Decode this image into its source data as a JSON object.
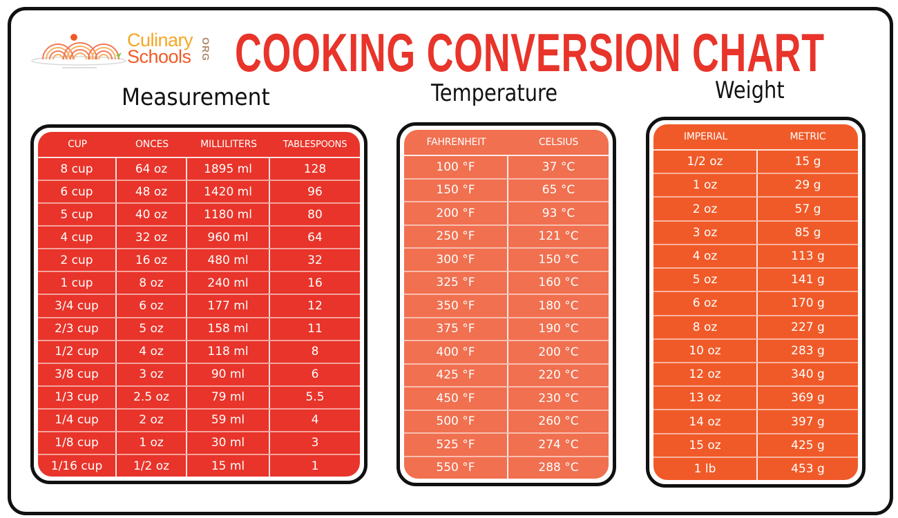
{
  "header": {
    "brand_line1": "Culinary",
    "brand_line2": "Schools",
    "brand_suffix": "ORG",
    "title": "COOKING CONVERSION CHART",
    "logo_icon": "spaghetti-plate-icon"
  },
  "colors": {
    "title_red": "#e8342a",
    "measurement_bg": "#e8342a",
    "temperature_bg": "#f07050",
    "weight_bg": "#f05a28",
    "brand_yellow": "#f5a623",
    "brand_orange": "#f05a28"
  },
  "measurement": {
    "title": "Measurement",
    "columns": [
      "CUP",
      "ONCES",
      "MILLILITERS",
      "TABLESPOONS"
    ],
    "rows": [
      [
        "8 cup",
        "64 oz",
        "1895 ml",
        "128"
      ],
      [
        "6 cup",
        "48 oz",
        "1420 ml",
        "96"
      ],
      [
        "5 cup",
        "40 oz",
        "1180 ml",
        "80"
      ],
      [
        "4 cup",
        "32 oz",
        "960 ml",
        "64"
      ],
      [
        "2 cup",
        "16 oz",
        "480 ml",
        "32"
      ],
      [
        "1 cup",
        "8 oz",
        "240 ml",
        "16"
      ],
      [
        "3/4 cup",
        "6 oz",
        "177 ml",
        "12"
      ],
      [
        "2/3 cup",
        "5 oz",
        "158 ml",
        "11"
      ],
      [
        "1/2 cup",
        "4 oz",
        "118 ml",
        "8"
      ],
      [
        "3/8 cup",
        "3 oz",
        "90 ml",
        "6"
      ],
      [
        "1/3 cup",
        "2.5 oz",
        "79 ml",
        "5.5"
      ],
      [
        "1/4 cup",
        "2 oz",
        "59 ml",
        "4"
      ],
      [
        "1/8 cup",
        "1 oz",
        "30 ml",
        "3"
      ],
      [
        "1/16 cup",
        "1/2 oz",
        "15 ml",
        "1"
      ]
    ]
  },
  "temperature": {
    "title": "Temperature",
    "columns": [
      "FAHRENHEIT",
      "CELSIUS"
    ],
    "rows": [
      [
        "100 °F",
        "37 °C"
      ],
      [
        "150 °F",
        "65 °C"
      ],
      [
        "200 °F",
        "93 °C"
      ],
      [
        "250 °F",
        "121 °C"
      ],
      [
        "300 °F",
        "150 °C"
      ],
      [
        "325 °F",
        "160 °C"
      ],
      [
        "350 °F",
        "180 °C"
      ],
      [
        "375 °F",
        "190 °C"
      ],
      [
        "400 °F",
        "200 °C"
      ],
      [
        "425 °F",
        "220 °C"
      ],
      [
        "450 °F",
        "230 °C"
      ],
      [
        "500 °F",
        "260 °C"
      ],
      [
        "525 °F",
        "274 °C"
      ],
      [
        "550 °F",
        "288 °C"
      ]
    ]
  },
  "weight": {
    "title": "Weight",
    "columns": [
      "IMPERIAL",
      "METRIC"
    ],
    "rows": [
      [
        "1/2 oz",
        "15 g"
      ],
      [
        "1 oz",
        "29 g"
      ],
      [
        "2 oz",
        "57 g"
      ],
      [
        "3 oz",
        "85 g"
      ],
      [
        "4 oz",
        "113 g"
      ],
      [
        "5 oz",
        "141 g"
      ],
      [
        "6 oz",
        "170 g"
      ],
      [
        "8 oz",
        "227 g"
      ],
      [
        "10 oz",
        "283 g"
      ],
      [
        "12 oz",
        "340 g"
      ],
      [
        "13 oz",
        "369 g"
      ],
      [
        "14 oz",
        "397 g"
      ],
      [
        "15 oz",
        "425 g"
      ],
      [
        "1 lb",
        "453 g"
      ]
    ]
  }
}
